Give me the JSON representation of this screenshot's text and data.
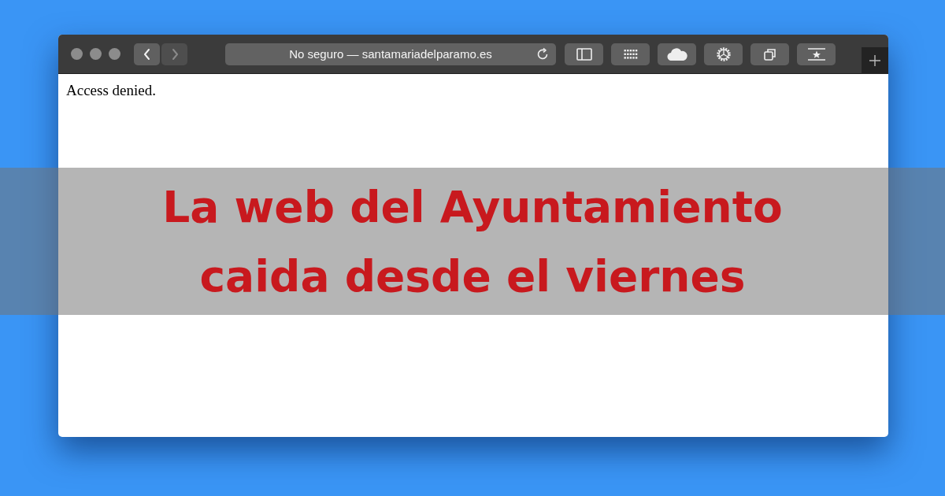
{
  "browser": {
    "nav_buttons": [
      {
        "kind": "back",
        "disabled": false
      },
      {
        "kind": "forward",
        "disabled": true
      }
    ],
    "address_bar": {
      "text": "No seguro — santamariadelparamo.es"
    },
    "page_text": "Access denied."
  },
  "banner": {
    "lines": [
      "La web del Ayuntamiento",
      "caida desde el viernes"
    ]
  }
}
